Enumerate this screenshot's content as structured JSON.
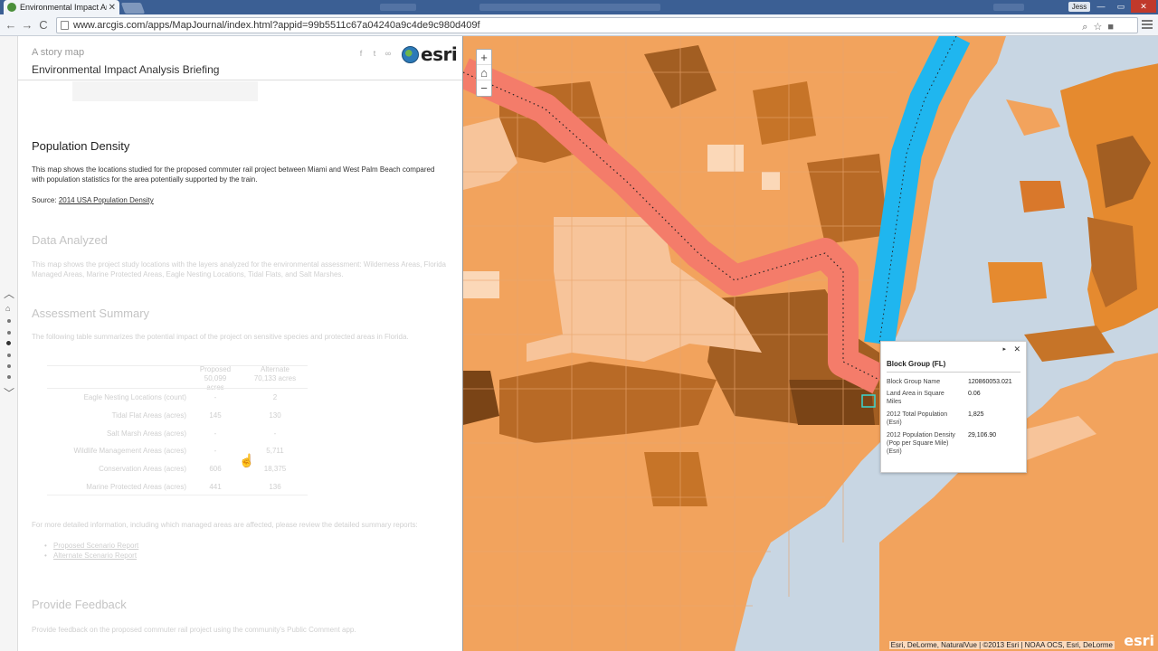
{
  "browser": {
    "tab_title": "Environmental Impact Ana",
    "tab_close": "✕",
    "user": "Jess",
    "url": "www.arcgis.com/apps/MapJournal/index.html?appid=99b5511c67a04240a9c4de9c980d409f",
    "back": "←",
    "forward": "→",
    "reload": "C",
    "minimize": "—",
    "maximize": "▭",
    "close": "✕"
  },
  "header": {
    "subtitle": "A story map",
    "title": "Environmental Impact Analysis Briefing",
    "logo_text": "esri"
  },
  "sections": {
    "population": {
      "title": "Population Density",
      "body": "This map shows the locations studied for the proposed commuter rail project between Miami and West Palm Beach compared with population statistics for the area potentially supported by the train.",
      "source_label": "Source:",
      "source_link": "2014 USA Population Density"
    },
    "data_analyzed": {
      "title": "Data Analyzed",
      "body": "This map shows the project study locations with the layers analyzed for the environmental assessment: Wilderness Areas, Florida Managed Areas, Marine Protected Areas, Eagle Nesting Locations, Tidal Flats, and Salt Marshes."
    },
    "assessment": {
      "title": "Assessment Summary",
      "body": "The following table summarizes the potential impact of the project on sensitive species and protected areas in Florida.",
      "table": {
        "headers": [
          {
            "name": "Proposed",
            "sub": "50,099 acres"
          },
          {
            "name": "Alternate",
            "sub": "70,133 acres"
          }
        ],
        "rows": [
          {
            "label": "Eagle Nesting Locations (count)",
            "proposed": "-",
            "alternate": "2"
          },
          {
            "label": "Tidal Flat Areas (acres)",
            "proposed": "145",
            "alternate": "130"
          },
          {
            "label": "Salt Marsh Areas (acres)",
            "proposed": "-",
            "alternate": "-"
          },
          {
            "label": "Wildlife Management Areas (acres)",
            "proposed": "-",
            "alternate": "5,711"
          },
          {
            "label": "Conservation Areas (acres)",
            "proposed": "606",
            "alternate": "18,375"
          },
          {
            "label": "Marine Protected Areas (acres)",
            "proposed": "441",
            "alternate": "136"
          }
        ]
      },
      "more_info": "For more detailed information, including which managed areas are affected, please review the detailed summary reports:",
      "links": [
        "Proposed Scenario Report",
        "Alternate Scenario Report"
      ]
    },
    "feedback": {
      "title": "Provide Feedback",
      "body": "Provide feedback on the proposed commuter rail project using the community's Public Comment app."
    }
  },
  "map": {
    "zoom_in": "+",
    "home": "⌂",
    "zoom_out": "−",
    "popup": {
      "title": "Block Group (FL)",
      "nav": "▸",
      "close": "✕",
      "fields": [
        {
          "label": "Block Group Name",
          "value": "120860053.021"
        },
        {
          "label": "Land Area in Square Miles",
          "value": "0.06"
        },
        {
          "label": "2012 Total Population (Esri)",
          "value": "1,825"
        },
        {
          "label": "2012 Population Density (Pop per Square Mile) (Esri)",
          "value": "29,106.90"
        }
      ]
    },
    "attribution": "Esri, DeLorme, NaturalVue | ©2013 Esri | NOAA OCS, Esri, DeLorme",
    "logo": "esri"
  }
}
